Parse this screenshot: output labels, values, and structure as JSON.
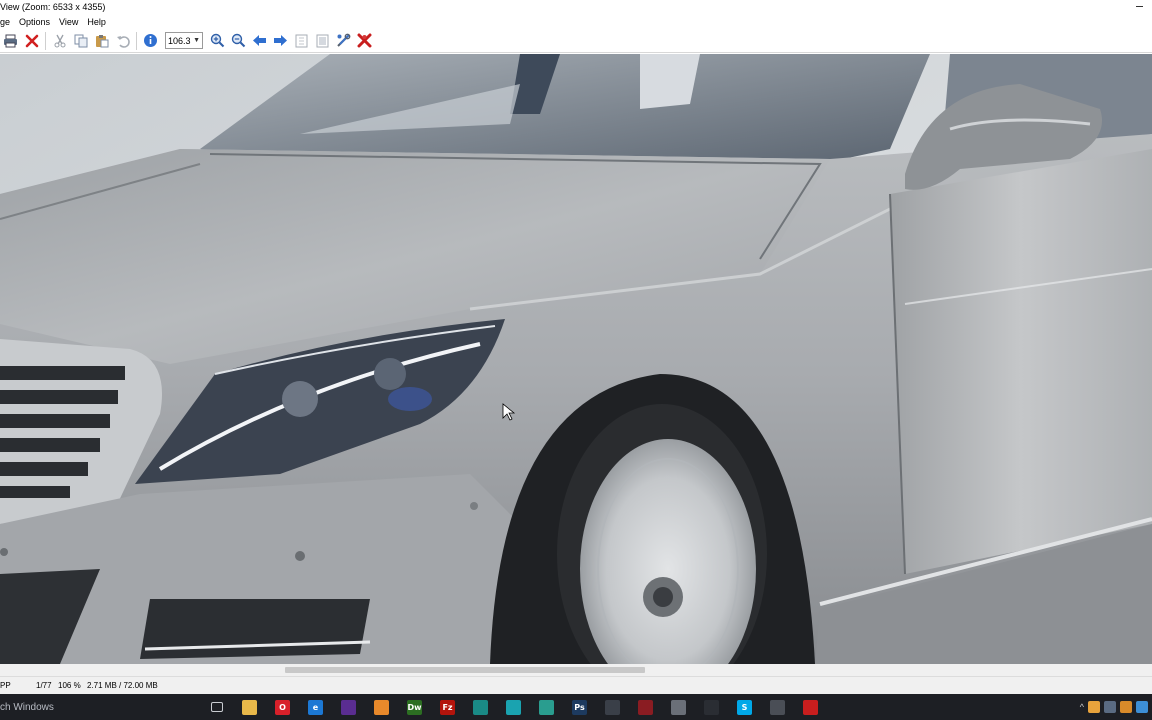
{
  "window": {
    "title": "View (Zoom: 6533 x 4355)"
  },
  "menu": {
    "items": [
      "ge",
      "Options",
      "View",
      "Help"
    ]
  },
  "toolbar": {
    "zoom_value": "106.3",
    "icons": [
      "print-icon",
      "delete-icon",
      "cut-icon",
      "copy-icon",
      "paste-icon",
      "undo-icon",
      "info-icon",
      "zoom-in-icon",
      "zoom-out-icon",
      "previous-icon",
      "next-icon",
      "first-page-icon",
      "last-page-icon",
      "settings-icon",
      "exit-icon"
    ]
  },
  "status": {
    "left": "PP",
    "position": "1/77",
    "zoom": "106 %",
    "memory": "2.71 MB / 72.00 MB"
  },
  "taskbar": {
    "search_text": "ch Windows",
    "apps": [
      {
        "name": "task-view-icon",
        "label": "",
        "color": "#1d1f24"
      },
      {
        "name": "file-explorer-icon",
        "label": "",
        "color": "#e8b84a"
      },
      {
        "name": "opera-icon",
        "label": "O",
        "color": "#d8202a"
      },
      {
        "name": "edge-icon",
        "label": "e",
        "color": "#1c78d4"
      },
      {
        "name": "mail-icon",
        "label": "",
        "color": "#5a2d91"
      },
      {
        "name": "app-orange-icon",
        "label": "",
        "color": "#e8892b"
      },
      {
        "name": "dreamweaver-icon",
        "label": "Dw",
        "color": "#2c6e22"
      },
      {
        "name": "filezilla-icon",
        "label": "Fz",
        "color": "#b3140c"
      },
      {
        "name": "app-teal-icon",
        "label": "",
        "color": "#1a8a86"
      },
      {
        "name": "app-cyan-icon",
        "label": "",
        "color": "#1aa3b0"
      },
      {
        "name": "app-sea-icon",
        "label": "",
        "color": "#2a9d8f"
      },
      {
        "name": "photoshop-icon",
        "label": "Ps",
        "color": "#1d3a5f"
      },
      {
        "name": "vector-app-icon",
        "label": "",
        "color": "#3a3f48"
      },
      {
        "name": "red-app-icon",
        "label": "",
        "color": "#8a1c22"
      },
      {
        "name": "generic-window-icon",
        "label": "",
        "color": "#6a6f78"
      },
      {
        "name": "media-player-icon",
        "label": "",
        "color": "#2a2d33"
      },
      {
        "name": "skype-icon",
        "label": "S",
        "color": "#00a8e8"
      },
      {
        "name": "app-gray-icon",
        "label": "",
        "color": "#4a4e56"
      },
      {
        "name": "irfanview-icon",
        "label": "",
        "color": "#c81e1e"
      }
    ]
  }
}
